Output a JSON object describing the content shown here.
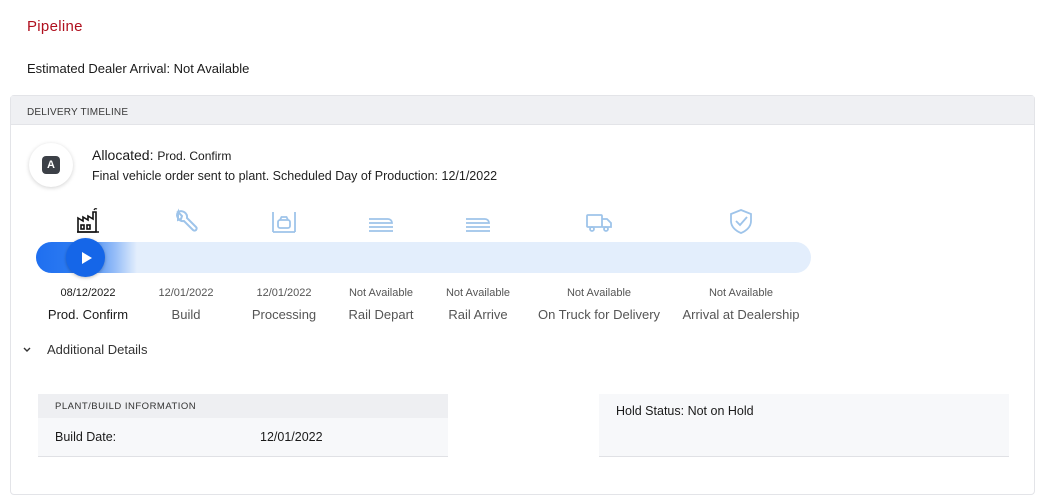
{
  "page": {
    "title": "Pipeline",
    "estimated_arrival": "Estimated Dealer Arrival: Not Available"
  },
  "timeline": {
    "header": "DELIVERY TIMELINE",
    "avatar_letter": "A",
    "status_label": "Allocated:",
    "status_value": "Prod. Confirm",
    "description": "Final vehicle order sent to plant. Scheduled Day of Production: 12/1/2022",
    "progress_fraction": 0.13,
    "accent_color": "#1566e8",
    "inactive_icon_color": "#9ec4ea",
    "steps": [
      {
        "label": "Prod. Confirm",
        "date": "08/12/2022",
        "icon": "factory-icon",
        "active": true
      },
      {
        "label": "Build",
        "date": "12/01/2022",
        "icon": "wrench-icon",
        "active": false
      },
      {
        "label": "Processing",
        "date": "12/01/2022",
        "icon": "car-garage-icon",
        "active": false
      },
      {
        "label": "Rail Depart",
        "date": "Not Available",
        "icon": "rail-icon",
        "active": false
      },
      {
        "label": "Rail Arrive",
        "date": "Not Available",
        "icon": "rail-icon",
        "active": false
      },
      {
        "label": "On Truck for Delivery",
        "date": "Not Available",
        "icon": "truck-icon",
        "active": false
      },
      {
        "label": "Arrival at Dealership",
        "date": "Not Available",
        "icon": "shield-check-icon",
        "active": false
      }
    ]
  },
  "details": {
    "toggle_label": "Additional Details",
    "plant": {
      "header": "PLANT/BUILD INFORMATION",
      "build_date_label": "Build Date:",
      "build_date_value": "12/01/2022"
    },
    "hold_status": "Hold Status: Not on Hold"
  }
}
